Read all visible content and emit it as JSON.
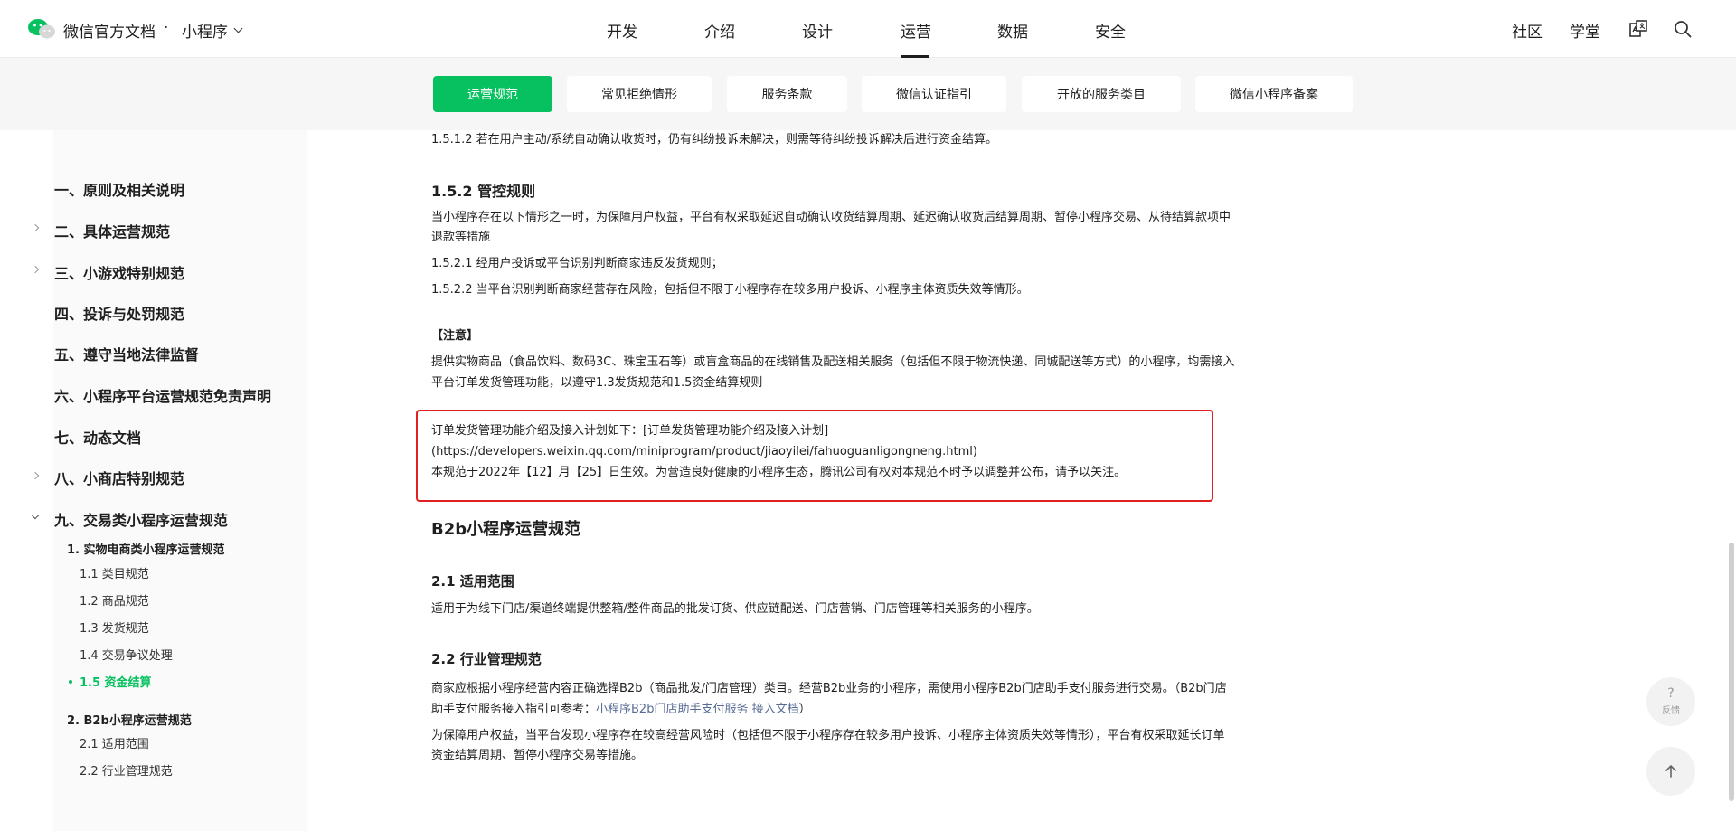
{
  "header": {
    "brand": "微信官方文档",
    "separator": "·",
    "product": "小程序",
    "nav": [
      "开发",
      "介绍",
      "设计",
      "运营",
      "数据",
      "安全"
    ],
    "active_nav": "运营",
    "right_links": [
      "社区",
      "学堂"
    ],
    "icons": [
      "translate-icon",
      "search-icon"
    ]
  },
  "subnav": [
    "运营规范",
    "常见拒绝情形",
    "服务条款",
    "微信认证指引",
    "开放的服务类目",
    "微信小程序备案"
  ],
  "sidebar": {
    "items": [
      "一、原则及相关说明",
      "二、具体运营规范",
      "三、小游戏特别规范",
      "四、投诉与处罚规范",
      "五、遵守当地法律监督",
      "六、小程序平台运营规范免责声明",
      "七、动态文档",
      "八、小商店特别规范",
      "九、交易类小程序运营规范"
    ],
    "sub": {
      "s1": "1. 实物电商类小程序运营规范",
      "s1_items": [
        "1.1 类目规范",
        "1.2 商品规范",
        "1.3 发货规范",
        "1.4 交易争议处理",
        "1.5 资金结算"
      ],
      "s2": "2. B2b小程序运营规范",
      "s2_items": [
        "2.1 适用范围",
        "2.2 行业管理规范"
      ]
    }
  },
  "content": {
    "p_1512": "1.5.1.2 若在用户主动/系统自动确认收货时，仍有纠纷投诉未解决，则需等待纠纷投诉解决后进行资金结算。",
    "h_152": "1.5.2 管控规则",
    "p_152_a": "当小程序存在以下情形之一时，为保障用户权益，平台有权采取延迟自动确认收货结算周期、延迟确认收货后结算周期、暂停小程序交易、从待结算款项中",
    "p_152_b": "退款等措施",
    "p_1521": "1.5.2.1 经用户投诉或平台识别判断商家违反发货规则；",
    "p_1522": "1.5.2.2 当平台识别判断商家经营存在风险，包括但不限于小程序存在较多用户投诉、小程序主体资质失效等情形。",
    "note_label": "【注意】",
    "note_a": "提供实物商品（食品饮料、数码3C、珠宝玉石等）或盲盒商品的在线销售及配送相关服务（包括但不限于物流快递、同城配送等方式）的小程序，均需接入",
    "note_b": "平台订单发货管理功能，以遵守1.3发货规范和1.5资金结算规则",
    "box_a": "订单发货管理功能介绍及接入计划如下：[订单发货管理功能介绍及接入计划]",
    "box_b": "(https://developers.weixin.qq.com/miniprogram/product/jiaoyilei/fahuoguanligongneng.html)",
    "box_c": "本规范于2022年【12】月【25】日生效。为营造良好健康的小程序生态，腾讯公司有权对本规范不时予以调整并公布，请予以关注。",
    "h_b2b": "B2b小程序运营规范",
    "h_21": "2.1 适用范围",
    "p_21": "适用于为线下门店/渠道终端提供整箱/整件商品的批发订货、供应链配送、门店营销、门店管理等相关服务的小程序。",
    "h_22": "2.2 行业管理规范",
    "p_22_a": "商家应根据小程序经营内容正确选择B2b（商品批发/门店管理）类目。经营B2b业务的小程序，需使用小程序B2b门店助手支付服务进行交易。（B2b门店",
    "p_22_b_pre": "助手支付服务接入指引可参考：",
    "p_22_b_link": "小程序B2b门店助手支付服务 接入文档",
    "p_22_b_post": "）",
    "p_22_c": "为保障用户权益，当平台发现小程序存在较高经营风险时（包括但不限于小程序存在较多用户投诉、小程序主体资质失效等情形），平台有权采取延长订单",
    "p_22_d": "资金结算周期、暂停小程序交易等措施。"
  },
  "floating": {
    "feedback_q": "?",
    "feedback_label": "反馈",
    "top_icon": "arrow-up-icon"
  },
  "colors": {
    "accent": "#07c160",
    "highlight_border": "#e02020",
    "link": "#576b95"
  }
}
